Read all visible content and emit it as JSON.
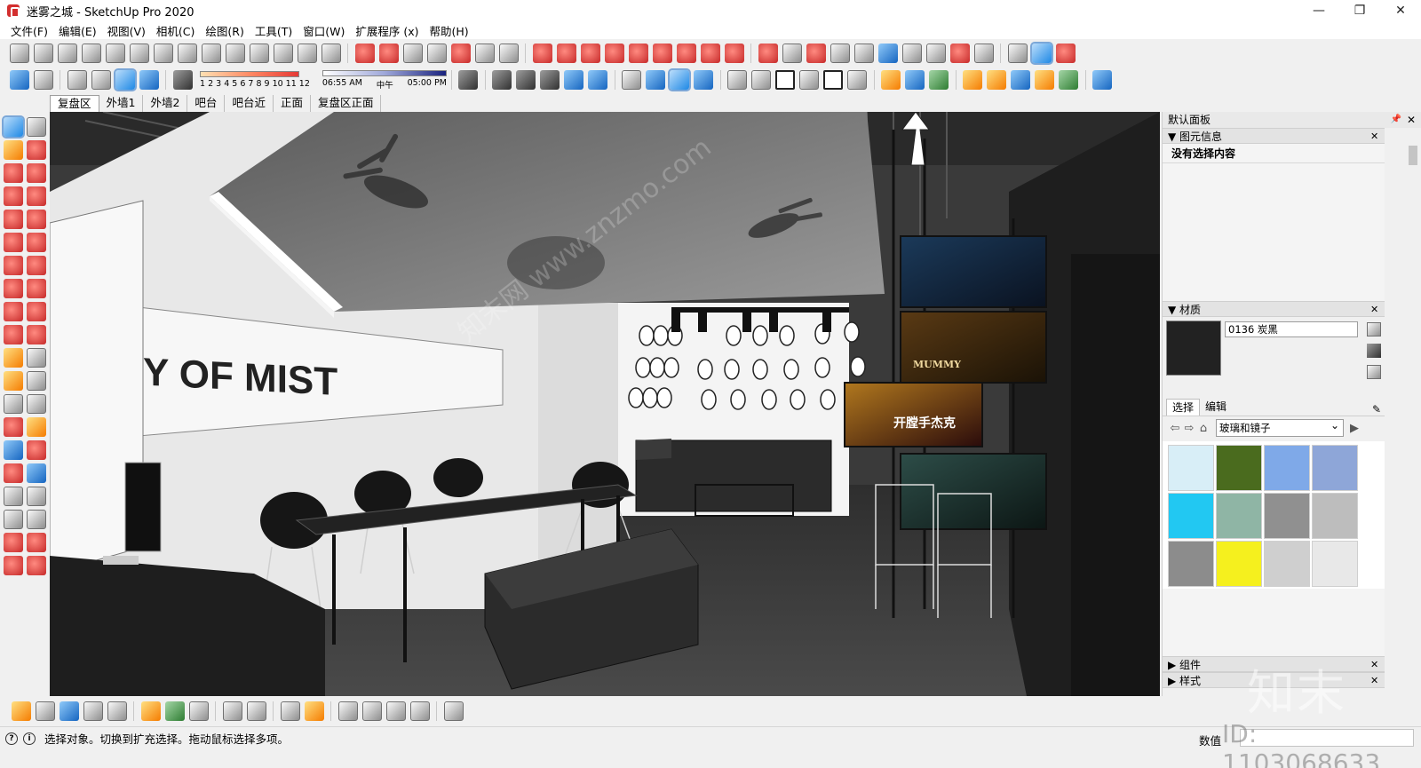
{
  "window": {
    "title": "迷雾之城 - SketchUp Pro 2020",
    "minimize": "—",
    "maximize": "❐",
    "close": "✕"
  },
  "menu": [
    "文件(F)",
    "编辑(E)",
    "视图(V)",
    "相机(C)",
    "绘图(R)",
    "工具(T)",
    "窗口(W)",
    "扩展程序 (x)",
    "帮助(H)"
  ],
  "shadow": {
    "months": "1 2 3 4 5 6 7 8 9 10 11 12",
    "time_start": "06:55 AM",
    "time_mid": "中午",
    "time_end": "05:00 PM"
  },
  "scene_tabs": [
    "复盘区",
    "外墙1",
    "外墙2",
    "吧台",
    "吧台近",
    "正面",
    "复盘区正面"
  ],
  "active_scene_tab": 0,
  "viewport": {
    "wall_text": "Y OF MIST",
    "poster_texts": [
      "MUMMY",
      "开膛手杰克"
    ],
    "watermarks": [
      "知末网 www.znzmo.com"
    ]
  },
  "panel": {
    "title": "默认面板",
    "entity_info": {
      "header": "图元信息",
      "body": "没有选择内容"
    },
    "materials": {
      "header": "材质",
      "material_name": "0136 炭黑",
      "tabs": [
        "选择",
        "编辑"
      ],
      "active_tab": 0,
      "library": "玻璃和镜子",
      "swatch_colors": [
        "#d8eef7",
        "#4a6b1e",
        "#7fa9e8",
        "#8ea6d8",
        "#22c8f2",
        "#8fb5a5",
        "#909090",
        "#bdbdbd",
        "#8c8c8c",
        "#f5f01e",
        "#cfcfcf",
        "#e8e8e8"
      ]
    },
    "components": {
      "header": "组件"
    },
    "styles": {
      "header": "样式"
    }
  },
  "status": {
    "hint": "选择对象。切换到扩充选择。拖动鼠标选择多项。",
    "measure_label": "数值",
    "measure_value": ""
  },
  "overlay": {
    "brand": "知末",
    "id": "ID: 1103068633"
  }
}
